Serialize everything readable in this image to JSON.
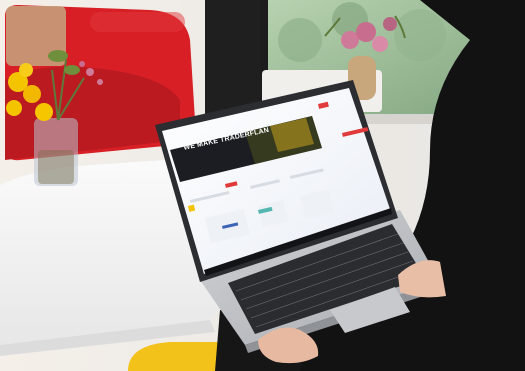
{
  "scene": {
    "description_alt": "",
    "laptop_screen": {
      "banner_text": "WE MAKE TRADERFLAN"
    }
  },
  "colors": {
    "red_armchair": "#d81f26",
    "white_table": "#f2f2f2",
    "black_clothing": "#121212",
    "laptop_silver": "#b9bbbf",
    "mustard_chair": "#f2c21b",
    "yellow_flowers": "#f4c400",
    "pink_flowers": "#d07a9a",
    "window_green": "#9fbf91"
  },
  "icons": [
    "laptop-icon",
    "flower-vase-icon",
    "armchair-icon"
  ]
}
